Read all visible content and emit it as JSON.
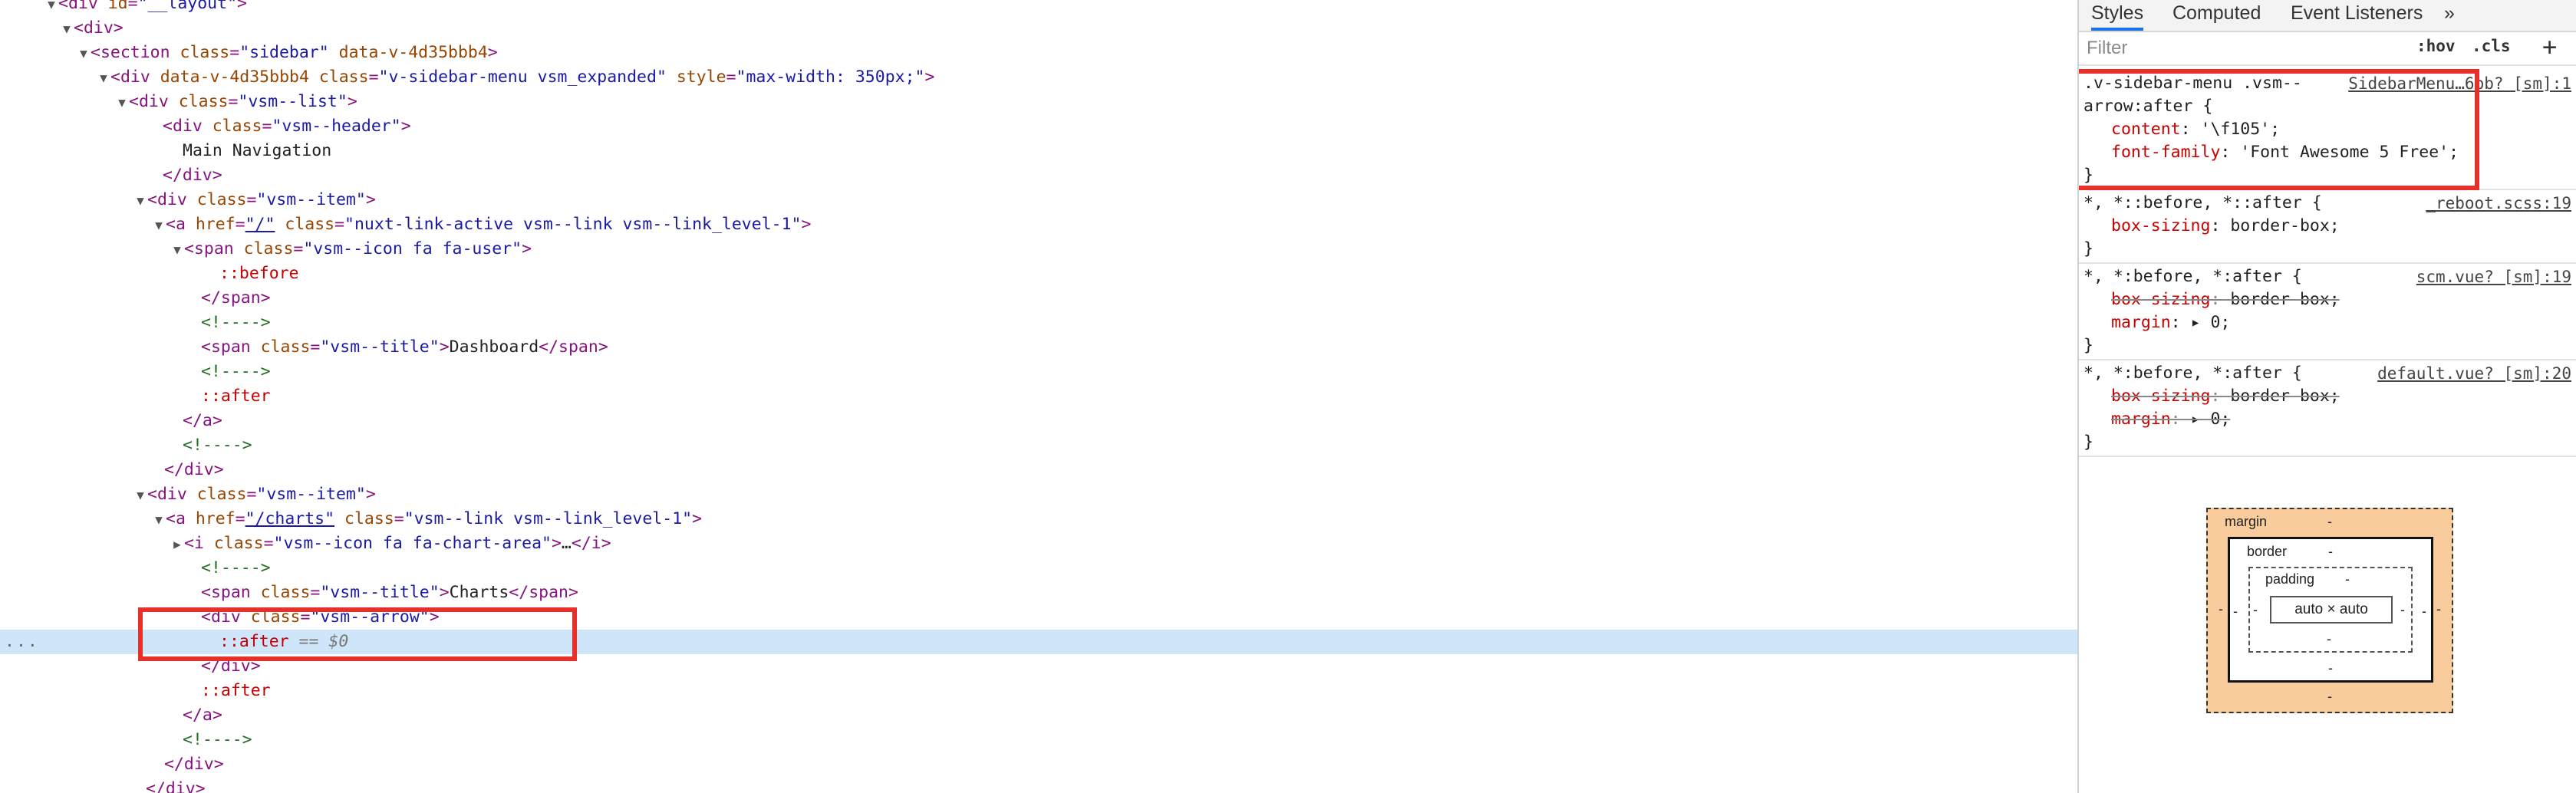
{
  "elements_panel": {
    "lines": [
      {
        "indent": 80,
        "tri": "down",
        "html": [
          [
            "tag",
            "<div "
          ],
          [
            "an",
            "id"
          ],
          [
            "tag",
            "="
          ],
          [
            "av",
            "\"__layout\""
          ],
          [
            "tag",
            ">"
          ]
        ]
      },
      {
        "indent": 100,
        "tri": "down",
        "html": [
          [
            "tag",
            "<div>"
          ]
        ]
      },
      {
        "indent": 122,
        "tri": "down",
        "html": [
          [
            "tag",
            "<section "
          ],
          [
            "an",
            "class"
          ],
          [
            "tag",
            "="
          ],
          [
            "av",
            "\"sidebar\""
          ],
          [
            "an",
            " data-v-4d35bbb4"
          ],
          [
            "tag",
            ">"
          ]
        ]
      },
      {
        "indent": 148,
        "tri": "down",
        "html": [
          [
            "tag",
            "<div "
          ],
          [
            "an",
            "data-v-4d35bbb4 class"
          ],
          [
            "tag",
            "="
          ],
          [
            "av",
            "\"v-sidebar-menu vsm_expanded\""
          ],
          [
            "an",
            " style"
          ],
          [
            "tag",
            "="
          ],
          [
            "av",
            "\"max-width: 350px;\""
          ],
          [
            "tag",
            ">"
          ]
        ]
      },
      {
        "indent": 172,
        "tri": "down",
        "html": [
          [
            "tag",
            "<div "
          ],
          [
            "an",
            "class"
          ],
          [
            "tag",
            "="
          ],
          [
            "av",
            "\"vsm--list\""
          ],
          [
            "tag",
            ">"
          ]
        ]
      },
      {
        "indent": 216,
        "tri": "",
        "html": [
          [
            "tag",
            "<div "
          ],
          [
            "an",
            "class"
          ],
          [
            "tag",
            "="
          ],
          [
            "av",
            "\"vsm--header\""
          ],
          [
            "tag",
            ">"
          ]
        ]
      },
      {
        "indent": 242,
        "tri": "",
        "html": [
          [
            "txt",
            "Main Navigation"
          ]
        ]
      },
      {
        "indent": 216,
        "tri": "",
        "html": [
          [
            "tag",
            "</div>"
          ]
        ]
      },
      {
        "indent": 196,
        "tri": "down",
        "html": [
          [
            "tag",
            "<div "
          ],
          [
            "an",
            "class"
          ],
          [
            "tag",
            "="
          ],
          [
            "av",
            "\"vsm--item\""
          ],
          [
            "tag",
            ">"
          ]
        ]
      },
      {
        "indent": 220,
        "tri": "down",
        "html": [
          [
            "tag",
            "<a "
          ],
          [
            "an",
            "href"
          ],
          [
            "tag",
            "="
          ],
          [
            "lnk",
            "\"/\""
          ],
          [
            "an",
            " class"
          ],
          [
            "tag",
            "="
          ],
          [
            "av",
            "\"nuxt-link-active vsm--link vsm--link_level-1\""
          ],
          [
            "tag",
            ">"
          ]
        ]
      },
      {
        "indent": 244,
        "tri": "down",
        "html": [
          [
            "tag",
            "<span "
          ],
          [
            "an",
            "class"
          ],
          [
            "tag",
            "="
          ],
          [
            "av",
            "\"vsm--icon fa fa-user\""
          ],
          [
            "tag",
            ">"
          ]
        ]
      },
      {
        "indent": 290,
        "tri": "",
        "html": [
          [
            "pse",
            "::before"
          ]
        ]
      },
      {
        "indent": 266,
        "tri": "",
        "html": [
          [
            "tag",
            "</span>"
          ]
        ]
      },
      {
        "indent": 266,
        "tri": "",
        "html": [
          [
            "com",
            "<!---->"
          ]
        ]
      },
      {
        "indent": 266,
        "tri": "",
        "html": [
          [
            "tag",
            "<span "
          ],
          [
            "an",
            "class"
          ],
          [
            "tag",
            "="
          ],
          [
            "av",
            "\"vsm--title\""
          ],
          [
            "tag",
            ">"
          ],
          [
            "txt",
            "Dashboard"
          ],
          [
            "tag",
            "</span>"
          ]
        ]
      },
      {
        "indent": 266,
        "tri": "",
        "html": [
          [
            "com",
            "<!---->"
          ]
        ]
      },
      {
        "indent": 266,
        "tri": "",
        "html": [
          [
            "pse",
            "::after"
          ]
        ]
      },
      {
        "indent": 242,
        "tri": "",
        "html": [
          [
            "tag",
            "</a>"
          ]
        ]
      },
      {
        "indent": 242,
        "tri": "",
        "html": [
          [
            "com",
            "<!---->"
          ]
        ]
      },
      {
        "indent": 218,
        "tri": "",
        "html": [
          [
            "tag",
            "</div>"
          ]
        ]
      },
      {
        "indent": 196,
        "tri": "down",
        "html": [
          [
            "tag",
            "<div "
          ],
          [
            "an",
            "class"
          ],
          [
            "tag",
            "="
          ],
          [
            "av",
            "\"vsm--item\""
          ],
          [
            "tag",
            ">"
          ]
        ]
      },
      {
        "indent": 220,
        "tri": "down",
        "html": [
          [
            "tag",
            "<a "
          ],
          [
            "an",
            "href"
          ],
          [
            "tag",
            "="
          ],
          [
            "lnk",
            "\"/charts\""
          ],
          [
            "an",
            " class"
          ],
          [
            "tag",
            "="
          ],
          [
            "av",
            "\"vsm--link vsm--link_level-1\""
          ],
          [
            "tag",
            ">"
          ]
        ]
      },
      {
        "indent": 244,
        "tri": "right",
        "html": [
          [
            "tag",
            "<i "
          ],
          [
            "an",
            "class"
          ],
          [
            "tag",
            "="
          ],
          [
            "av",
            "\"vsm--icon fa fa-chart-area\""
          ],
          [
            "tag",
            ">"
          ],
          [
            "txt",
            "…"
          ],
          [
            "tag",
            "</i>"
          ]
        ]
      },
      {
        "indent": 266,
        "tri": "",
        "html": [
          [
            "com",
            "<!---->"
          ]
        ]
      },
      {
        "indent": 266,
        "tri": "",
        "html": [
          [
            "tag",
            "<span "
          ],
          [
            "an",
            "class"
          ],
          [
            "tag",
            "="
          ],
          [
            "av",
            "\"vsm--title\""
          ],
          [
            "tag",
            ">"
          ],
          [
            "txt",
            "Charts"
          ],
          [
            "tag",
            "</span>"
          ]
        ]
      },
      {
        "indent": 266,
        "tri": "",
        "html": [
          [
            "tag",
            "<div "
          ],
          [
            "an",
            "class"
          ],
          [
            "tag",
            "="
          ],
          [
            "av",
            "\"vsm--arrow\""
          ],
          [
            "tag",
            ">"
          ]
        ]
      },
      {
        "indent": 290,
        "tri": "",
        "html": [
          [
            "pse",
            "::after"
          ],
          [
            "dim",
            " == $0"
          ]
        ],
        "selected": true
      },
      {
        "indent": 266,
        "tri": "",
        "html": [
          [
            "tag",
            "</div>"
          ]
        ]
      },
      {
        "indent": 266,
        "tri": "",
        "html": [
          [
            "pse",
            "::after"
          ]
        ]
      },
      {
        "indent": 242,
        "tri": "",
        "html": [
          [
            "tag",
            "</a>"
          ]
        ]
      },
      {
        "indent": 242,
        "tri": "",
        "html": [
          [
            "com",
            "<!---->"
          ]
        ]
      },
      {
        "indent": 218,
        "tri": "",
        "html": [
          [
            "tag",
            "</div>"
          ]
        ]
      },
      {
        "indent": 194,
        "tri": "",
        "html": [
          [
            "tag",
            "</div>"
          ]
        ]
      }
    ],
    "ellipsis": "..."
  },
  "styles_pane": {
    "tabs": [
      "Styles",
      "Computed",
      "Event Listeners",
      "»"
    ],
    "active_tab": "Styles",
    "filter_placeholder": "Filter",
    "hov_label": ":hov",
    "cls_label": ".cls",
    "add_label": "+",
    "rules": [
      {
        "selector_lines": [
          ".v-sidebar-menu .vsm--",
          "arrow:after {"
        ],
        "source": "SidebarMenu…6bb? [sm]:1",
        "props": [
          {
            "name": "content",
            "value": "'\\f105';",
            "struck": false
          },
          {
            "name": "font-family",
            "value": "'Font Awesome 5 Free';",
            "struck": false
          }
        ],
        "highlighted": true
      },
      {
        "selector_lines": [
          "*, *::before, *::after {"
        ],
        "source": "_reboot.scss:19",
        "props": [
          {
            "name": "box-sizing",
            "value": "border-box;",
            "struck": false
          }
        ]
      },
      {
        "selector_lines": [
          "*, *:before, *:after {"
        ],
        "source": "scm.vue? [sm]:19",
        "props": [
          {
            "name": "box-sizing",
            "value": "border-box;",
            "struck": true
          },
          {
            "name": "margin",
            "value": "▸ 0;",
            "struck": false
          }
        ]
      },
      {
        "selector_lines": [
          "*, *:before, *:after {"
        ],
        "source": "default.vue? [sm]:20",
        "props": [
          {
            "name": "box-sizing",
            "value": "border-box;",
            "struck": true
          },
          {
            "name": "margin",
            "value": "▸ 0;",
            "struck": true
          }
        ]
      }
    ],
    "close_brace": "}",
    "box_model": {
      "margin_label": "margin",
      "border_label": "border",
      "padding_label": "padding",
      "content": "auto × auto",
      "dash": "-",
      "colors": {
        "margin": "#f9cc9d",
        "border": "#ffffff",
        "padding": "#ffffff"
      }
    }
  },
  "colors": {
    "highlight_box": "#e8302a",
    "selected_row": "#cfe6fa",
    "tab_active": "#1a73e8"
  }
}
